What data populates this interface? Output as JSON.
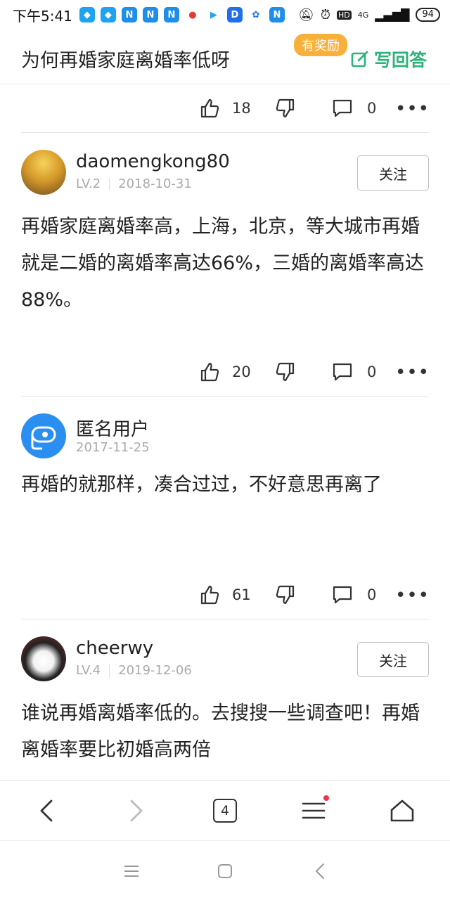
{
  "status_bar": {
    "time": "下午5:41",
    "notification_icons": [
      "bird-app-icon",
      "bird-app-icon",
      "n-app-icon",
      "n-app-icon",
      "n-app-icon",
      "map-pin-icon",
      "youku-icon",
      "d-app-icon",
      "news-app-icon",
      "n-app-icon"
    ],
    "network": "4G",
    "hd": "HD",
    "battery": "94"
  },
  "header": {
    "title": "为何再婚家庭离婚率低呀",
    "reward_badge": "有奖励",
    "write_answer": "写回答",
    "accent_color": "#2bb37a",
    "badge_color": "#f7b13b"
  },
  "answers": [
    {
      "likes": "18",
      "comments": "0"
    },
    {
      "username": "daomengkong80",
      "level": "LV.2",
      "date": "2018-10-31",
      "follow": "关注",
      "text": "再婚家庭离婚率高，上海，北京，等大城市再婚就是二婚的离婚率高达66%，三婚的离婚率高达88%。",
      "likes": "20",
      "comments": "0"
    },
    {
      "username": "匿名用户",
      "date": "2017-11-25",
      "text": "再婚的就那样，凑合过过，不好意思再离了",
      "likes": "61",
      "comments": "0"
    },
    {
      "username": "cheerwy",
      "level": "LV.4",
      "date": "2019-12-06",
      "follow": "关注",
      "text": "谁说再婚离婚率低的。去搜搜一些调查吧！再婚离婚率要比初婚高两倍"
    }
  ],
  "browser_bar": {
    "tab_count": "4"
  }
}
